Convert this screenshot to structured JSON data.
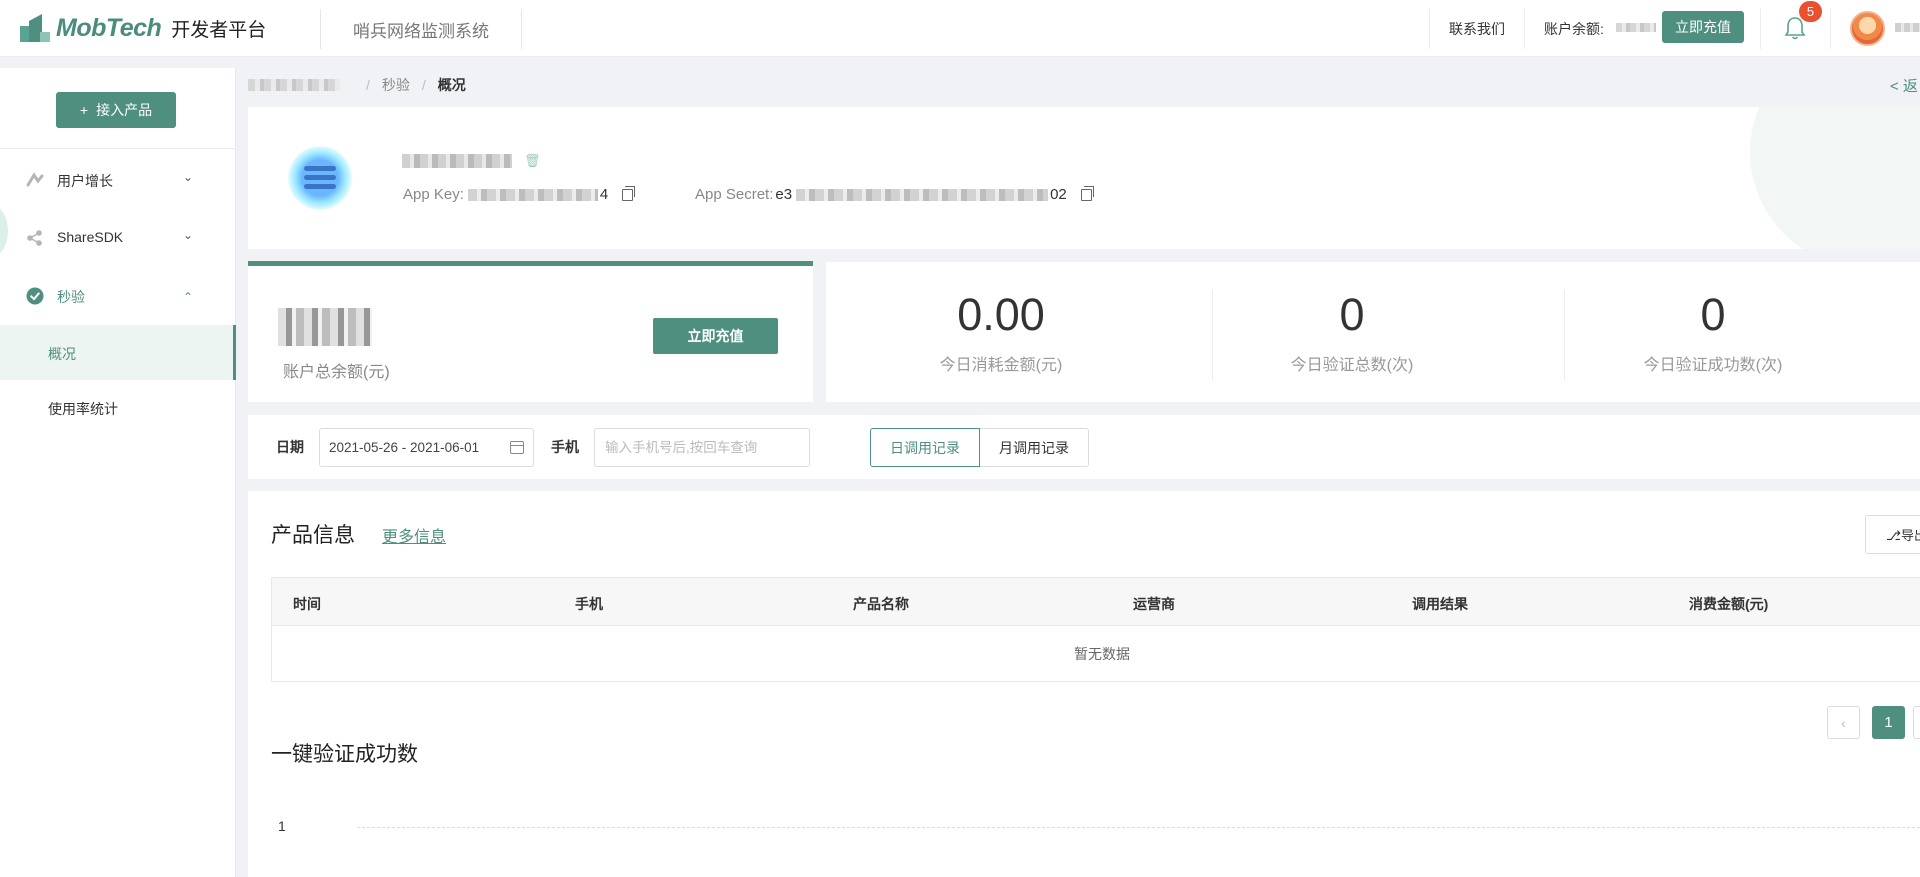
{
  "header": {
    "brand": "MobTech",
    "platform": "开发者平台",
    "system": "哨兵网络监测系统",
    "contact": "联系我们",
    "balance_label": "账户余额:",
    "recharge": "立即充值",
    "notification_count": "5"
  },
  "sidebar": {
    "add_product": "接入产品",
    "groups": [
      {
        "label": "用户增长",
        "icon": "growth-icon"
      },
      {
        "label": "ShareSDK",
        "icon": "share-icon"
      },
      {
        "label": "秒验",
        "icon": "verify-icon"
      }
    ],
    "subitems": [
      "概况",
      "使用率统计"
    ]
  },
  "breadcrumb": {
    "items": [
      "秒验",
      "概况"
    ],
    "back": "< 返"
  },
  "app": {
    "key_label": "App Key:",
    "key_suffix": "4",
    "secret_label": "App Secret:",
    "secret_prefix": "e3",
    "secret_suffix": "02"
  },
  "balance": {
    "label": "账户总余额(元)",
    "button": "立即充值"
  },
  "stats": [
    {
      "value": "0.00",
      "label": "今日消耗金额(元)"
    },
    {
      "value": "0",
      "label": "今日验证总数(次)"
    },
    {
      "value": "0",
      "label": "今日验证成功数(次)"
    }
  ],
  "filter": {
    "date_label": "日期",
    "date_value": "2021-05-26 - 2021-06-01",
    "phone_label": "手机",
    "phone_placeholder": "输入手机号后,按回车查询",
    "tab_day": "日调用记录",
    "tab_month": "月调用记录"
  },
  "product": {
    "title": "产品信息",
    "more": "更多信息",
    "export": "导出",
    "columns": [
      "时间",
      "手机",
      "产品名称",
      "运营商",
      "调用结果",
      "消费金额(元)"
    ],
    "empty": "暂无数据",
    "current_page": "1"
  },
  "chart": {
    "title": "一键验证成功数",
    "y_tick": "1"
  },
  "chart_data": {
    "type": "line",
    "title": "一键验证成功数",
    "x": [],
    "series": [],
    "yticks": [
      1
    ],
    "grid": true
  }
}
